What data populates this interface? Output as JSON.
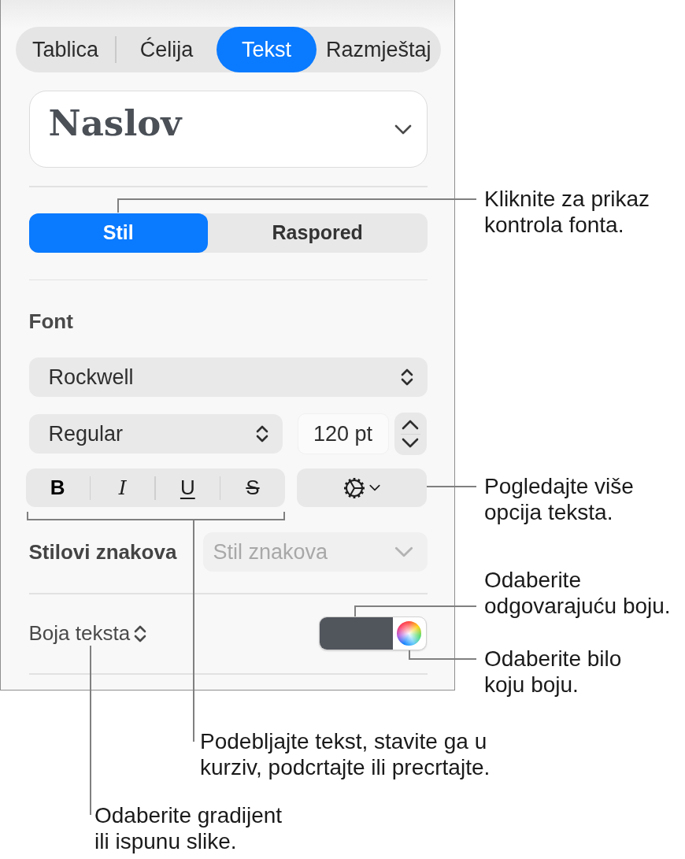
{
  "tabs": [
    {
      "label": "Tablica",
      "selected": false
    },
    {
      "label": "Ćelija",
      "selected": false
    },
    {
      "label": "Tekst",
      "selected": true
    },
    {
      "label": "Razmještaj",
      "selected": false
    }
  ],
  "paragraph_style": {
    "value": "Naslov"
  },
  "segments": [
    {
      "label": "Stil",
      "selected": true
    },
    {
      "label": "Raspored",
      "selected": false
    }
  ],
  "font": {
    "title": "Font",
    "family": "Rockwell",
    "typeface": "Regular",
    "size": "120 pt",
    "style_buttons": [
      {
        "label": "B",
        "kind": "bold"
      },
      {
        "label": "I",
        "kind": "italic"
      },
      {
        "label": "U",
        "kind": "underline"
      },
      {
        "label": "S",
        "kind": "strikethrough"
      }
    ]
  },
  "character_styles": {
    "label": "Stilovi znakova",
    "placeholder": "Stil znakova",
    "disabled": true
  },
  "text_color": {
    "label": "Boja teksta",
    "color": "#51555c"
  },
  "callouts": [
    {
      "lines": [
        "Kliknite za prikaz",
        "kontrola fonta."
      ]
    },
    {
      "lines": [
        "Pogledajte više",
        "opcija teksta."
      ]
    },
    {
      "lines": [
        "Odaberite",
        "odgovarajuću boju."
      ]
    },
    {
      "lines": [
        "Odaberite bilo",
        "koju boju."
      ]
    },
    {
      "lines": [
        "Podebljajte tekst, stavite ga u",
        "kurziv, podcrtajte ili precrtajte."
      ]
    },
    {
      "lines": [
        "Odaberite gradijent",
        "ili ispunu slike."
      ]
    }
  ]
}
